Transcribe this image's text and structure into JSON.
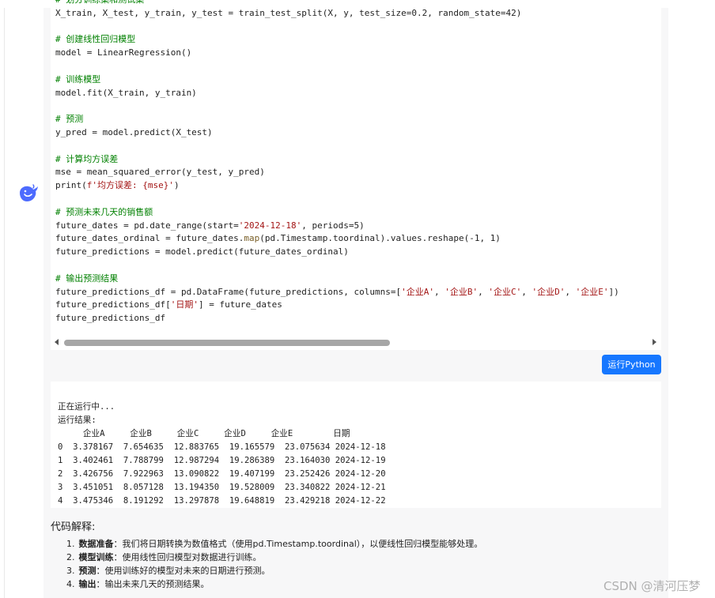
{
  "code": {
    "lines": [
      [
        {
          "t": "# 划分训练集和测试集",
          "c": "com"
        }
      ],
      [
        {
          "t": "X_train, X_test, y_train, y_test = train_test_split(X, y, test_size=0.2, random_state=42)",
          "c": ""
        }
      ],
      [],
      [
        {
          "t": "# 创建线性回归模型",
          "c": "com"
        }
      ],
      [
        {
          "t": "model = LinearRegression()",
          "c": ""
        }
      ],
      [],
      [
        {
          "t": "# 训练模型",
          "c": "com"
        }
      ],
      [
        {
          "t": "model.fit(X_train, y_train)",
          "c": ""
        }
      ],
      [],
      [
        {
          "t": "# 预测",
          "c": "com"
        }
      ],
      [
        {
          "t": "y_pred = model.predict(X_test)",
          "c": ""
        }
      ],
      [],
      [
        {
          "t": "# 计算均方误差",
          "c": "com"
        }
      ],
      [
        {
          "t": "mse = mean_squared_error(y_test, y_pred)",
          "c": ""
        }
      ],
      [
        {
          "t": "print(",
          "c": ""
        },
        {
          "t": "f'均方误差: {mse}'",
          "c": "str"
        },
        {
          "t": ")",
          "c": ""
        }
      ],
      [],
      [
        {
          "t": "# 预测未来几天的销售额",
          "c": "com"
        }
      ],
      [
        {
          "t": "future_dates = pd.date_range(start=",
          "c": ""
        },
        {
          "t": "'2024-12-18'",
          "c": "str"
        },
        {
          "t": ", periods=5)",
          "c": ""
        }
      ],
      [
        {
          "t": "future_dates_ordinal = future_dates.",
          "c": ""
        },
        {
          "t": "map",
          "c": "fn"
        },
        {
          "t": "(pd.Timestamp.toordinal).values.reshape(-1, 1)",
          "c": ""
        }
      ],
      [
        {
          "t": "future_predictions = model.predict(future_dates_ordinal)",
          "c": ""
        }
      ],
      [],
      [
        {
          "t": "# 输出预测结果",
          "c": "com"
        }
      ],
      [
        {
          "t": "future_predictions_df = pd.DataFrame(future_predictions, columns=[",
          "c": ""
        },
        {
          "t": "'企业A'",
          "c": "str"
        },
        {
          "t": ", ",
          "c": ""
        },
        {
          "t": "'企业B'",
          "c": "str"
        },
        {
          "t": ", ",
          "c": ""
        },
        {
          "t": "'企业C'",
          "c": "str"
        },
        {
          "t": ", ",
          "c": ""
        },
        {
          "t": "'企业D'",
          "c": "str"
        },
        {
          "t": ", ",
          "c": ""
        },
        {
          "t": "'企业E'",
          "c": "str"
        },
        {
          "t": "])",
          "c": ""
        }
      ],
      [
        {
          "t": "future_predictions_df[",
          "c": ""
        },
        {
          "t": "'日期'",
          "c": "str"
        },
        {
          "t": "] = future_dates",
          "c": ""
        }
      ],
      [
        {
          "t": "future_predictions_df",
          "c": ""
        }
      ]
    ]
  },
  "run_button": {
    "label": "运行Python"
  },
  "output": {
    "status": "正在运行中...",
    "result_label": "运行结果:",
    "table": {
      "headers": [
        "企业A",
        "企业B",
        "企业C",
        "企业D",
        "企业E",
        "日期"
      ],
      "rows": [
        [
          "0",
          "3.378167",
          "7.654635",
          "12.883765",
          "19.165579",
          "23.075634",
          "2024-12-18"
        ],
        [
          "1",
          "3.402461",
          "7.788799",
          "12.987294",
          "19.286389",
          "23.164030",
          "2024-12-19"
        ],
        [
          "2",
          "3.426756",
          "7.922963",
          "13.090822",
          "19.407199",
          "23.252426",
          "2024-12-20"
        ],
        [
          "3",
          "3.451051",
          "8.057128",
          "13.194350",
          "19.528009",
          "23.340822",
          "2024-12-21"
        ],
        [
          "4",
          "3.475346",
          "8.191292",
          "13.297878",
          "19.648819",
          "23.429218",
          "2024-12-22"
        ]
      ]
    }
  },
  "explanation": {
    "title": "代码解释:",
    "items": [
      {
        "num": "1.",
        "term": "数据准备",
        "text": "：我们将日期转换为数值格式（使用pd.Timestamp.toordinal），以便线性回归模型能够处理。"
      },
      {
        "num": "2.",
        "term": "模型训练",
        "text": "：使用线性回归模型对数据进行训练。"
      },
      {
        "num": "3.",
        "term": "预测",
        "text": "：使用训练好的模型对未来的日期进行预测。"
      },
      {
        "num": "4.",
        "term": "输出",
        "text": "：输出未来几天的预测结果。"
      }
    ]
  },
  "watermark": "CSDN @清河压梦",
  "colors": {
    "accent": "#1677ff",
    "comment": "#008000",
    "string": "#a31515",
    "function": "#795e26"
  },
  "icons": {
    "avatar": "deepseek-whale-icon"
  }
}
